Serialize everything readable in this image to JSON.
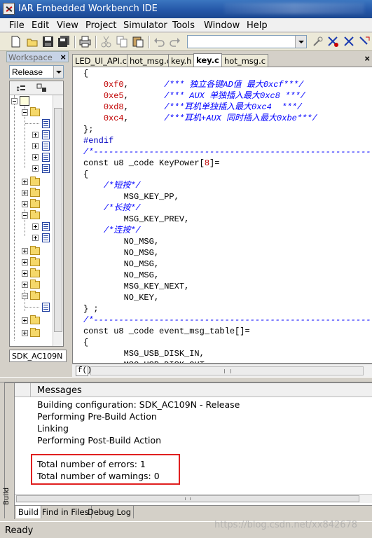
{
  "window": {
    "title": "IAR Embedded Workbench IDE"
  },
  "menu": [
    "File",
    "Edit",
    "View",
    "Project",
    "Simulator",
    "Tools",
    "Window",
    "Help"
  ],
  "workspace": {
    "label": "Workspace",
    "close": "×",
    "config": "Release",
    "project_tab": "SDK_AC109N"
  },
  "editor": {
    "tabs": [
      "LED_UI_API.c",
      "hot_msg.c",
      "key.h",
      "key.c",
      "hot_msg.c"
    ],
    "active_tab": "key.c",
    "close": "×",
    "func_label": "f()",
    "lines": [
      [
        [
          "cb",
          "{"
        ]
      ],
      [
        [
          "cb",
          "    "
        ],
        [
          "cn",
          "0xf0"
        ],
        [
          "cb",
          ",       "
        ],
        [
          "cc",
          "/*** 独立各键AD值 最大0xcf***/"
        ]
      ],
      [
        [
          "cb",
          "    "
        ],
        [
          "cn",
          "0xe5"
        ],
        [
          "cb",
          ",       "
        ],
        [
          "cc",
          "/*** AUX 单独插入最大0xc8 ***/"
        ]
      ],
      [
        [
          "cb",
          "    "
        ],
        [
          "cn",
          "0xd8"
        ],
        [
          "cb",
          ",       "
        ],
        [
          "cc",
          "/***耳机单独插入最大0xc4  ***/"
        ]
      ],
      [
        [
          "cb",
          "    "
        ],
        [
          "cn",
          "0xc4"
        ],
        [
          "cb",
          ",       "
        ],
        [
          "cc",
          "/***耳机+AUX 同时插入最大0xbe***/"
        ]
      ],
      [
        [
          "cb",
          "};"
        ]
      ],
      [
        [
          "cp",
          "#endif"
        ]
      ],
      [
        [
          "cc",
          "/*------------------------------------------------------------"
        ]
      ],
      [
        [
          "cb",
          "const u8 _code KeyPower["
        ],
        [
          "cn",
          "8"
        ],
        [
          "cb",
          "]="
        ]
      ],
      [
        [
          "cb",
          "{"
        ]
      ],
      [
        [
          "cb",
          "    "
        ],
        [
          "cc",
          "/*短按*/"
        ]
      ],
      [
        [
          "cb",
          "        MSG_KEY_PP,"
        ]
      ],
      [
        [
          "cb",
          "    "
        ],
        [
          "cc",
          "/*长按*/"
        ]
      ],
      [
        [
          "cb",
          "        MSG_KEY_PREV,"
        ]
      ],
      [
        [
          "cb",
          "    "
        ],
        [
          "cc",
          "/*连按*/"
        ]
      ],
      [
        [
          "cb",
          "        NO_MSG,"
        ]
      ],
      [
        [
          "cb",
          "        NO_MSG,"
        ]
      ],
      [
        [
          "cb",
          "        NO_MSG,"
        ]
      ],
      [
        [
          "cb",
          "        NO_MSG,"
        ]
      ],
      [
        [
          "cb",
          "        MSG_KEY_NEXT,"
        ]
      ],
      [
        [
          "cb",
          "        NO_KEY,"
        ]
      ],
      [
        [
          "cb",
          "} ;"
        ]
      ],
      [
        [
          "cc",
          "/*------------------------------------------------------------"
        ]
      ],
      [
        [
          "cb",
          "const u8 _code event_msg_table[]="
        ]
      ],
      [
        [
          "cb",
          "{"
        ]
      ],
      [
        [
          "cb",
          "        MSG_USB_DISK_IN,"
        ]
      ],
      [
        [
          "cb",
          "        MSG_USB_DISK_OUT,"
        ]
      ]
    ]
  },
  "build": {
    "side_label": "Build",
    "header": "Messages",
    "messages": [
      "Building configuration: SDK_AC109N - Release",
      "Performing Pre-Build Action",
      "Linking",
      "Performing Post-Build Action",
      "",
      "Total number of errors: 1",
      "Total number of warnings: 0"
    ],
    "tabs": [
      "Build",
      "Find in Files",
      "Debug Log"
    ],
    "active_tab": "Build"
  },
  "status": {
    "text": "Ready"
  },
  "watermark": "https://blog.csdn.net/xx842678",
  "colors": {
    "highlight_box": "#e02020",
    "comment": "#0000ff",
    "number": "#c00000",
    "preproc": "#0000c0"
  }
}
